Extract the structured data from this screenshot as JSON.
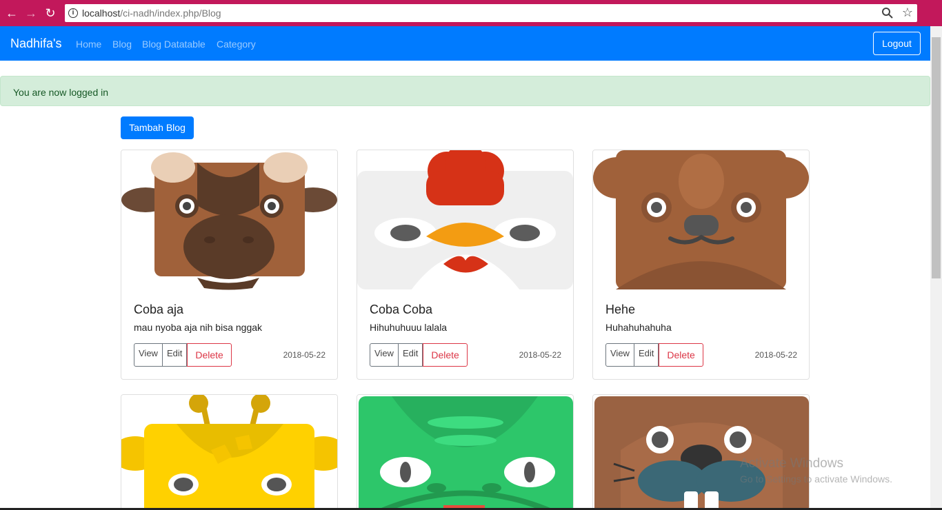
{
  "browser": {
    "url_host": "localhost",
    "url_path": "/ci-nadh/index.php/Blog",
    "back_icon": "arrow-left-icon",
    "forward_icon": "arrow-right-icon",
    "reload_icon": "reload-icon",
    "info_icon": "info-icon",
    "zoom_icon": "magnifier-icon",
    "star_icon": "star-icon"
  },
  "navbar": {
    "brand": "Nadhifa's",
    "links": [
      "Home",
      "Blog",
      "Blog Datatable",
      "Category"
    ],
    "logout": "Logout",
    "color": "#007bff"
  },
  "alert": {
    "message": "You are now logged in"
  },
  "add_button": "Tambah Blog",
  "cards": [
    {
      "title": "Coba aja",
      "text": "mau nyoba aja nih bisa nggak",
      "view": "View",
      "edit": "Edit",
      "delete": "Delete",
      "date": "2018-05-22",
      "image": "buffalo-avatar"
    },
    {
      "title": "Coba Coba",
      "text": "Hihuhuhuuu lalala",
      "view": "View",
      "edit": "Edit",
      "delete": "Delete",
      "date": "2018-05-22",
      "image": "chicken-avatar"
    },
    {
      "title": "Hehe",
      "text": "Huhahuhahuha",
      "view": "View",
      "edit": "Edit",
      "delete": "Delete",
      "date": "2018-05-22",
      "image": "beaver-avatar"
    },
    {
      "image": "giraffe-avatar"
    },
    {
      "image": "crocodile-avatar"
    },
    {
      "image": "walrus-avatar"
    }
  ],
  "watermark": {
    "line1": "Activate Windows",
    "line2": "Go to Settings to activate Windows."
  }
}
